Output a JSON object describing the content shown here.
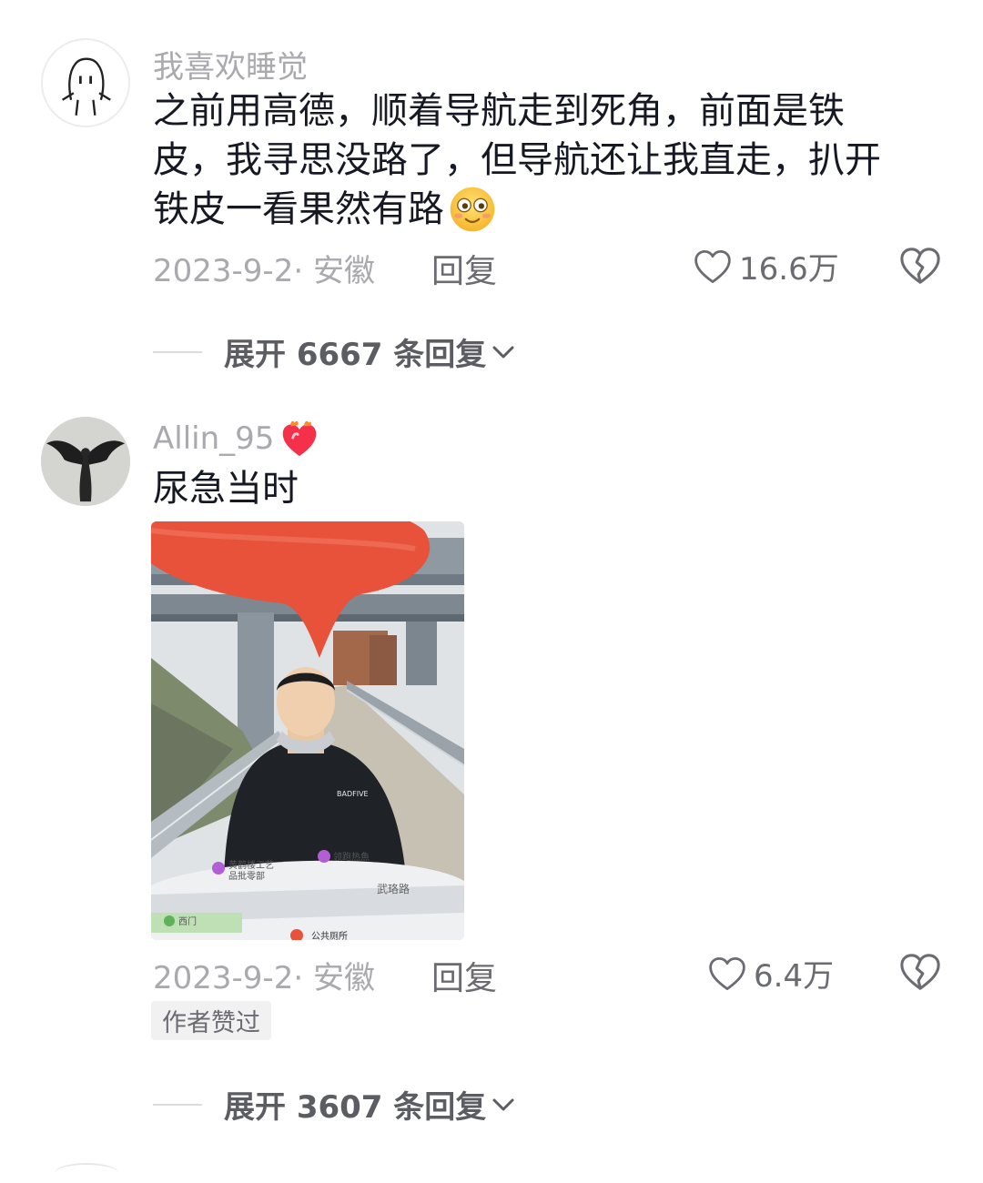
{
  "comments": [
    {
      "username": "我喜欢睡觉",
      "text_lines": [
        "之前用高德，顺着导航走到死角，前面是铁",
        "皮，我寻思没路了，但导航还让我直走，扒开",
        "铁皮一看果然有路"
      ],
      "emoji": "flushed-smile-emoji",
      "date_location": "2023-9-2· 安徽",
      "reply_label": "回复",
      "like_count": "16.6万",
      "expand_label": "展开 6667 条回复"
    },
    {
      "username": "Allin_95",
      "user_badge_icon": "fire-heart-icon",
      "text": "尿急当时",
      "image": {
        "description_icon": "video-thumbnail",
        "map_labels": [
          "黄鹤楼工艺",
          "品批零部",
          "领跑热魚",
          "武珞路",
          "西门",
          "公共厕所"
        ],
        "shirt_text": "BADFIVE"
      },
      "date_location": "2023-9-2· 安徽",
      "reply_label": "回复",
      "like_count": "6.4万",
      "author_liked_badge": "作者赞过",
      "expand_label": "展开 3607 条回复"
    }
  ],
  "colors": {
    "text_primary": "#161823",
    "text_secondary": "#a9a9ae",
    "pin_red": "#e8513a"
  }
}
